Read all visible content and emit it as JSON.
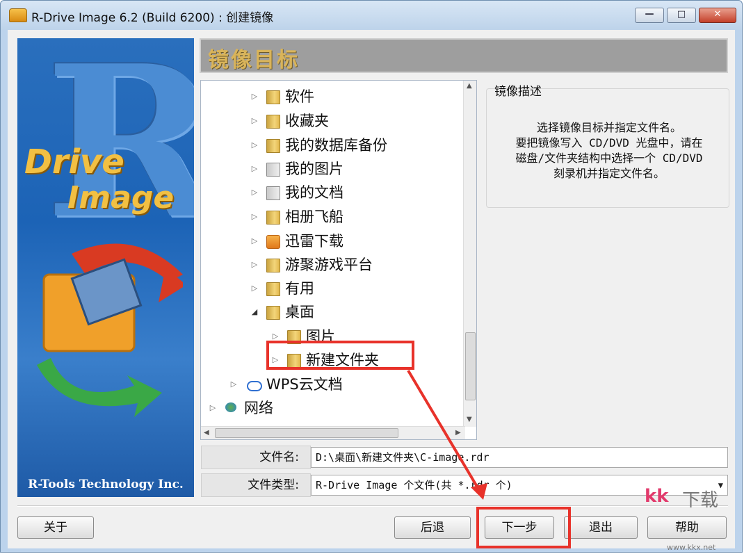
{
  "window": {
    "title": "R-Drive Image 6.2 (Build 6200) : 创建镜像",
    "controls": {
      "minimize": "—",
      "maximize": "□",
      "close": "✕"
    }
  },
  "banner": {
    "brand_line1": "Drive",
    "brand_line2": "Image",
    "big_letter": "R",
    "company": "R-Tools Technology Inc."
  },
  "header": {
    "title": "镜像目标"
  },
  "tree": {
    "items": [
      {
        "label": "软件",
        "icon": "folder-icon",
        "expanded": false
      },
      {
        "label": "收藏夹",
        "icon": "favorites-folder-icon",
        "expanded": false
      },
      {
        "label": "我的数据库备份",
        "icon": "folder-icon",
        "expanded": false
      },
      {
        "label": "我的图片",
        "icon": "pictures-folder-icon",
        "expanded": false
      },
      {
        "label": "我的文档",
        "icon": "documents-folder-icon",
        "expanded": false
      },
      {
        "label": "相册飞船",
        "icon": "folder-icon",
        "expanded": false
      },
      {
        "label": "迅雷下载",
        "icon": "thunder-download-folder-icon",
        "expanded": false
      },
      {
        "label": "游聚游戏平台",
        "icon": "folder-icon",
        "expanded": false
      },
      {
        "label": "有用",
        "icon": "folder-icon",
        "expanded": false
      },
      {
        "label": "桌面",
        "icon": "folder-icon",
        "expanded": true
      },
      {
        "label": "图片",
        "icon": "folder-icon",
        "expanded": false
      },
      {
        "label": "新建文件夹",
        "icon": "folder-icon",
        "expanded": false,
        "selected": true
      },
      {
        "label": "WPS云文档",
        "icon": "cloud-icon",
        "expanded": false
      },
      {
        "label": "网络",
        "icon": "network-icon",
        "expanded": false
      }
    ]
  },
  "description": {
    "title": "镜像描述",
    "text": "选择镜像目标并指定文件名。\n要把镜像写入 CD/DVD 光盘中，请在\n磁盘/文件夹结构中选择一个 CD/DVD\n刻录机并指定文件名。"
  },
  "fields": {
    "filename_label": "文件名:",
    "filename_value": "D:\\桌面\\新建文件夹\\C-image.rdr",
    "filetype_label": "文件类型:",
    "filetype_value": "R-Drive Image 个文件(共 *.rdr 个)"
  },
  "buttons": {
    "about": "关于",
    "back": "后退",
    "next": "下一步",
    "exit": "退出",
    "help": "帮助"
  },
  "watermark": {
    "brand": "kk",
    "text": "下载",
    "url": "www.kkx.net"
  },
  "colors": {
    "annotation": "#e8322a",
    "header_text": "#d9b45a",
    "banner_blue": "#1c63b6"
  }
}
